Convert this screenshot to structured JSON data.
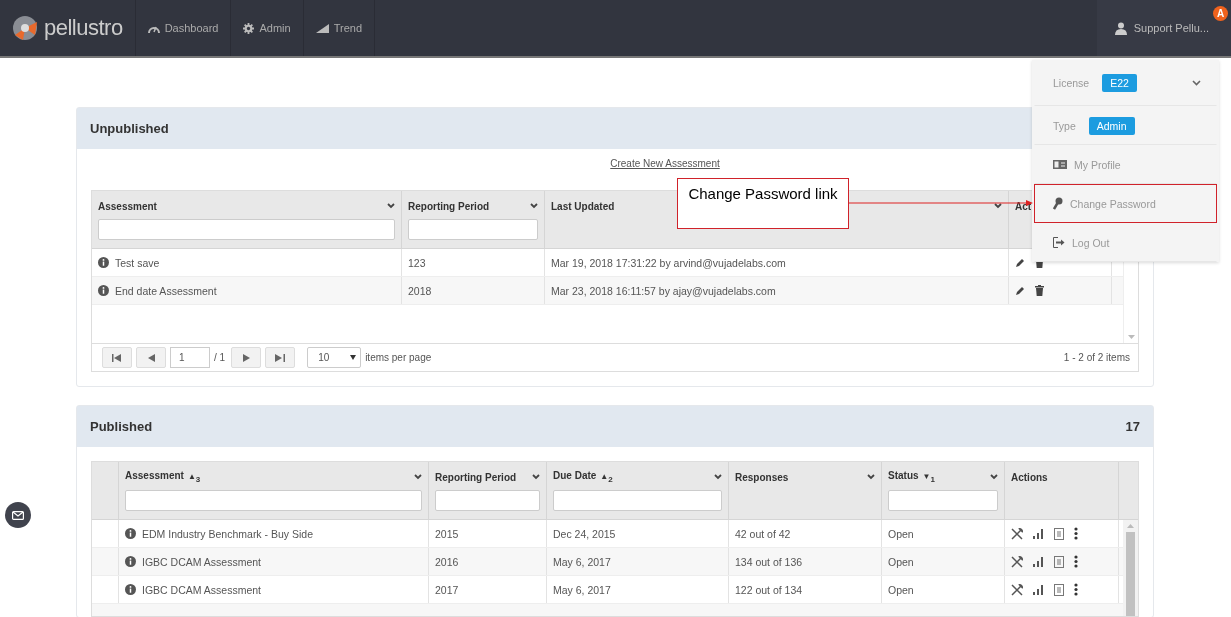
{
  "nav": {
    "brand": "pellustro",
    "items": [
      {
        "label": "Dashboard"
      },
      {
        "label": "Admin"
      },
      {
        "label": "Trend"
      }
    ],
    "user": "Support Pellu...",
    "badge": "A"
  },
  "user_menu": {
    "items": [
      {
        "kind": "badge",
        "label": "License",
        "badge": "E22",
        "dropdown": true,
        "highlighted": false
      },
      {
        "kind": "badge",
        "label": "Type",
        "badge": "Admin",
        "dropdown": false,
        "highlighted": false
      },
      {
        "kind": "link",
        "label": "My Profile",
        "highlighted": false
      },
      {
        "kind": "link",
        "label": "Change Password",
        "highlighted": true
      },
      {
        "kind": "link",
        "label": "Log Out",
        "highlighted": false
      }
    ]
  },
  "annotation": {
    "text": "Change Password link"
  },
  "unpublished": {
    "title": "Unpublished",
    "create_link": "Create New Assessment",
    "columns": [
      {
        "label": "Assessment",
        "menu": true,
        "filter": true
      },
      {
        "label": "Reporting Period",
        "menu": true,
        "filter": true
      },
      {
        "label": "Last Updated",
        "menu": true,
        "filter": false
      },
      {
        "label": "Act",
        "filter": false
      }
    ],
    "rows": [
      {
        "cells": [
          "Test save",
          "123",
          "Mar 19, 2018 17:31:22 by arvind@vujadelabs.com"
        ]
      },
      {
        "cells": [
          "End date Assessment",
          "2018",
          "Mar 23, 2018 16:11:57 by ajay@vujadelabs.com"
        ]
      }
    ],
    "pager": {
      "page": "1",
      "total_pages": "/ 1",
      "page_size": "10",
      "page_size_label": "items per page",
      "summary": "1 - 2 of 2 items"
    }
  },
  "published": {
    "title": "Published",
    "count": "17",
    "columns": [
      {
        "label": "Assessment",
        "menu": true,
        "filter": true,
        "sort": {
          "arrow": "▲",
          "order": "3"
        }
      },
      {
        "label": "Reporting Period",
        "menu": true,
        "filter": true
      },
      {
        "label": "Due Date",
        "menu": true,
        "filter": true,
        "sort": {
          "arrow": "▲",
          "order": "2"
        }
      },
      {
        "label": "Responses",
        "menu": true,
        "filter": false
      },
      {
        "label": "Status",
        "menu": true,
        "filter": true,
        "sort": {
          "arrow": "▼",
          "order": "1"
        }
      },
      {
        "label": "Actions",
        "menu": false,
        "filter": false
      }
    ],
    "rows": [
      {
        "cells": [
          "EDM Industry Benchmark - Buy Side",
          "2015",
          "Dec 24, 2015",
          "42 out of 42",
          "Open"
        ]
      },
      {
        "cells": [
          "IGBC DCAM Assessment",
          "2016",
          "May 6, 2017",
          "134 out of 136",
          "Open"
        ]
      },
      {
        "cells": [
          "IGBC DCAM Assessment",
          "2017",
          "May 6, 2017",
          "122 out of 134",
          "Open"
        ]
      }
    ]
  }
}
